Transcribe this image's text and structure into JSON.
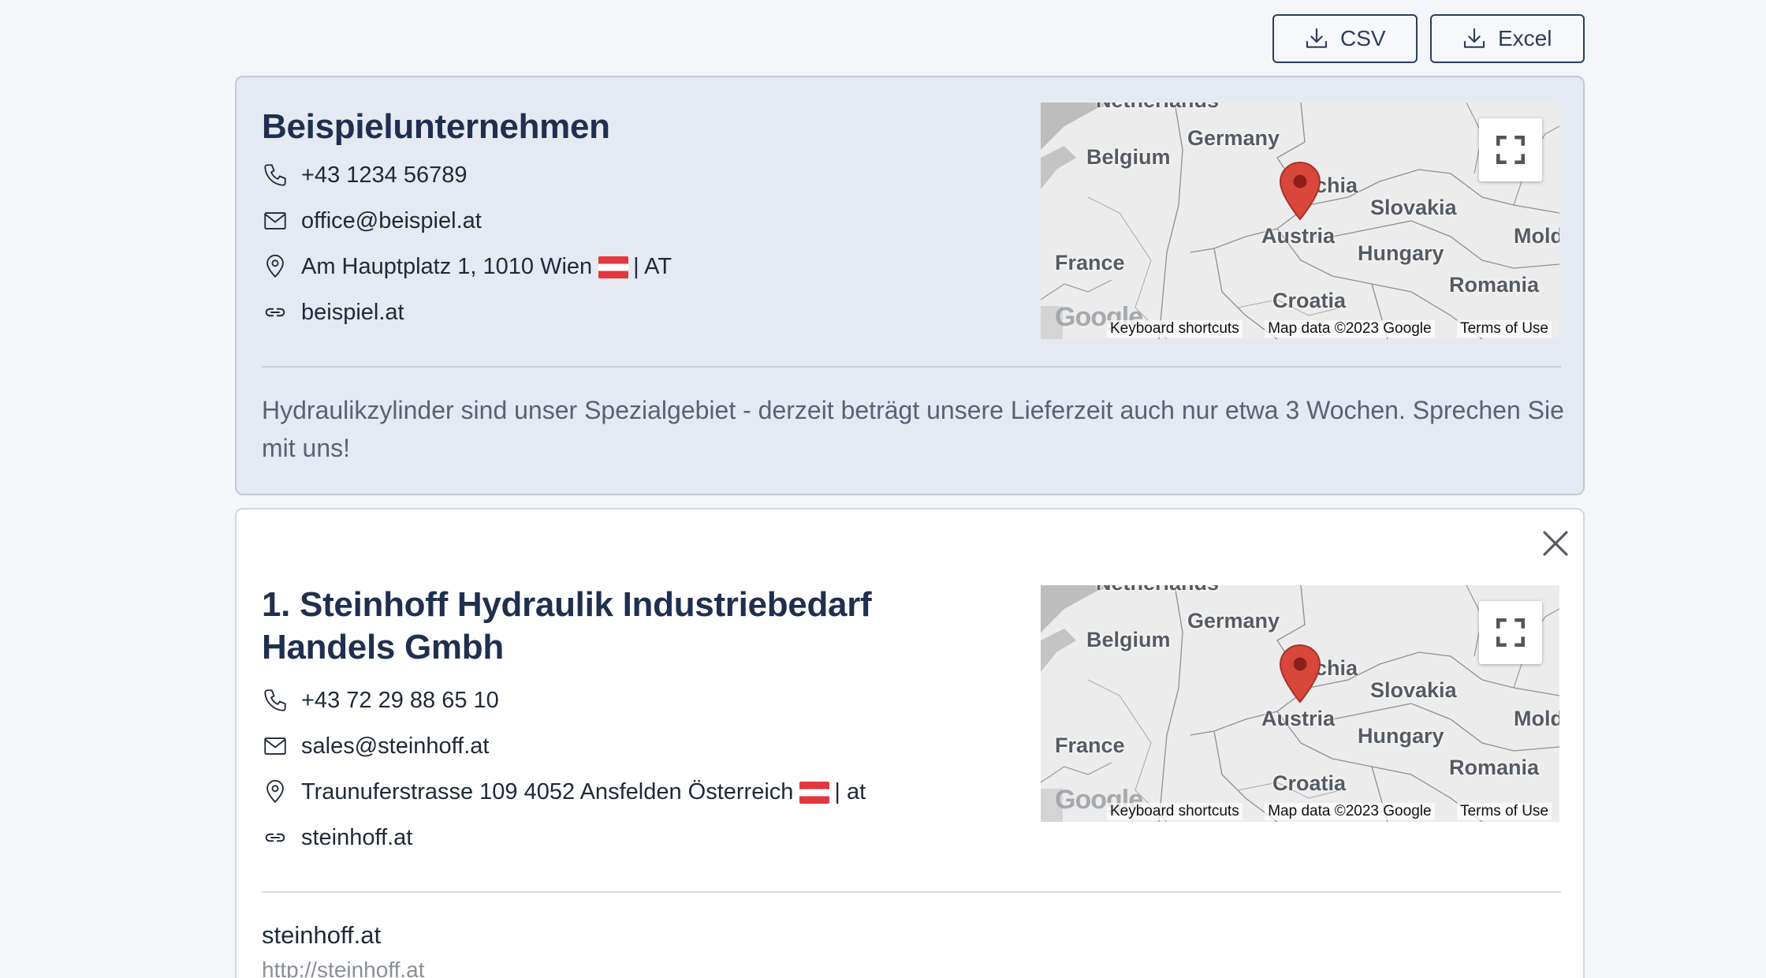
{
  "toolbar": {
    "csv_label": "CSV",
    "excel_label": "Excel"
  },
  "featured": {
    "name": "Beispielunternehmen",
    "phone": "+43 1234 56789",
    "email": "office@beispiel.at",
    "address": "Am Hauptplatz 1, 1010 Wien",
    "country_code": "| AT",
    "website": "beispiel.at",
    "description": "Hydraulikzylinder sind unser Spezialgebiet - derzeit beträgt unsere Lieferzeit auch nur etwa 3 Wochen. Sprechen Sie mit uns!"
  },
  "result": {
    "name": "1. Steinhoff Hydraulik Industriebedarf Handels Gmbh",
    "phone": "+43 72 29 88 65 10",
    "email": "sales@steinhoff.at",
    "address": "Traunuferstrasse 109 4052 Ansfelden Österreich",
    "country_code": "| at",
    "website": "steinhoff.at",
    "website_title": "steinhoff.at",
    "website_url": "http://steinhoff.at"
  },
  "map": {
    "labels": {
      "top": "Netherlands",
      "belgium": "Belgium",
      "germany": "Germany",
      "czechia": "chia",
      "slovakia": "Slovakia",
      "austria": "Austria",
      "hungary": "Hungary",
      "moldova": "Mold",
      "france": "France",
      "romania": "Romania",
      "croatia": "Croatia"
    },
    "logo": "Google",
    "footer": {
      "shortcuts": "Keyboard shortcuts",
      "data": "Map data ©2023 Google",
      "terms": "Terms of Use"
    }
  },
  "colors": {
    "accent": "#2c3e5f",
    "flag_red": "#e3373e",
    "pin": "#d9473b"
  },
  "icons": {
    "export": "download-icon",
    "phone": "phone-icon",
    "email": "mail-icon",
    "address": "map-pin-icon",
    "website": "link-icon",
    "close": "close-icon",
    "fullscreen": "fullscreen-icon"
  }
}
